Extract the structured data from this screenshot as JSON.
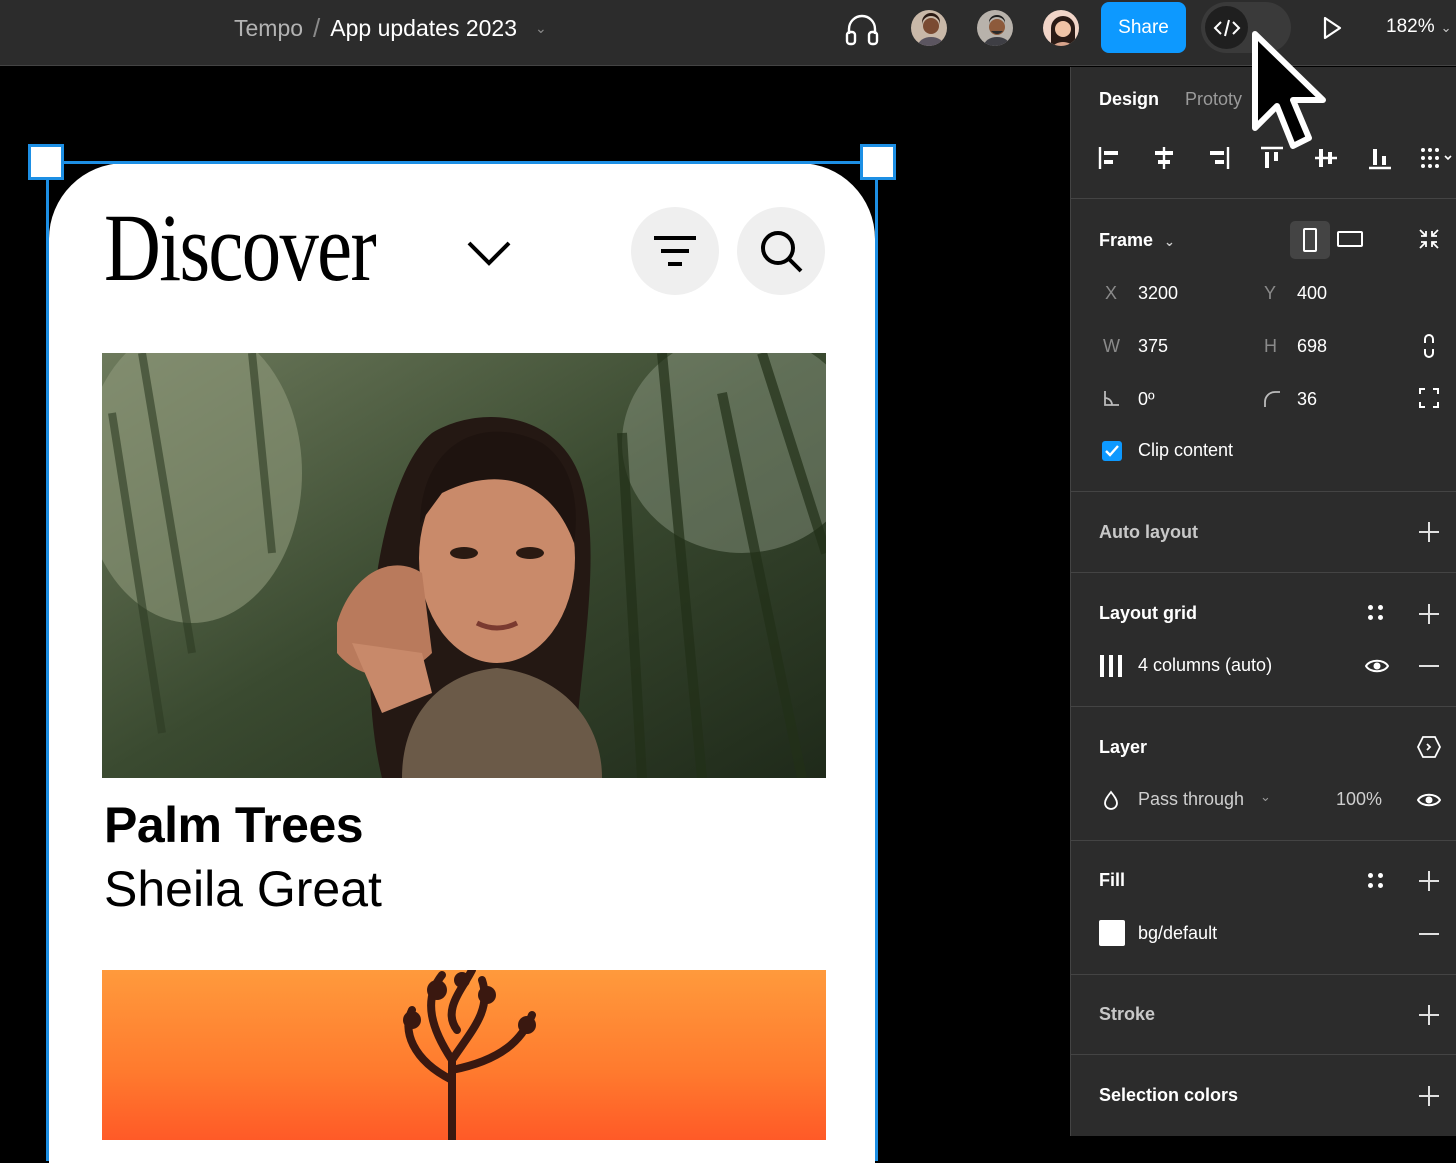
{
  "topbar": {
    "team": "Tempo",
    "separator": "/",
    "file": "App updates 2023",
    "share_label": "Share",
    "zoom": "182%"
  },
  "canvas": {
    "title": "Discover",
    "card1": {
      "title": "Palm Trees",
      "subtitle": "Sheila Great"
    }
  },
  "panel": {
    "tabs": {
      "design": "Design",
      "prototype": "Prototy"
    },
    "frame": {
      "label": "Frame",
      "x_label": "X",
      "x": "3200",
      "y_label": "Y",
      "y": "400",
      "w_label": "W",
      "w": "375",
      "h_label": "H",
      "h": "698",
      "rotation": "0º",
      "radius": "36",
      "clip_content": "Clip content"
    },
    "auto_layout": "Auto layout",
    "layout_grid": {
      "label": "Layout grid",
      "item": "4 columns (auto)"
    },
    "layer": {
      "label": "Layer",
      "mode": "Pass through",
      "opacity": "100%"
    },
    "fill": {
      "label": "Fill",
      "item": "bg/default",
      "color": "#ffffff"
    },
    "stroke": "Stroke",
    "selection_colors": "Selection colors"
  },
  "colors": {
    "accent": "#0d99ff",
    "selection": "#1d8fe4",
    "panel_bg": "#2c2c2c"
  }
}
